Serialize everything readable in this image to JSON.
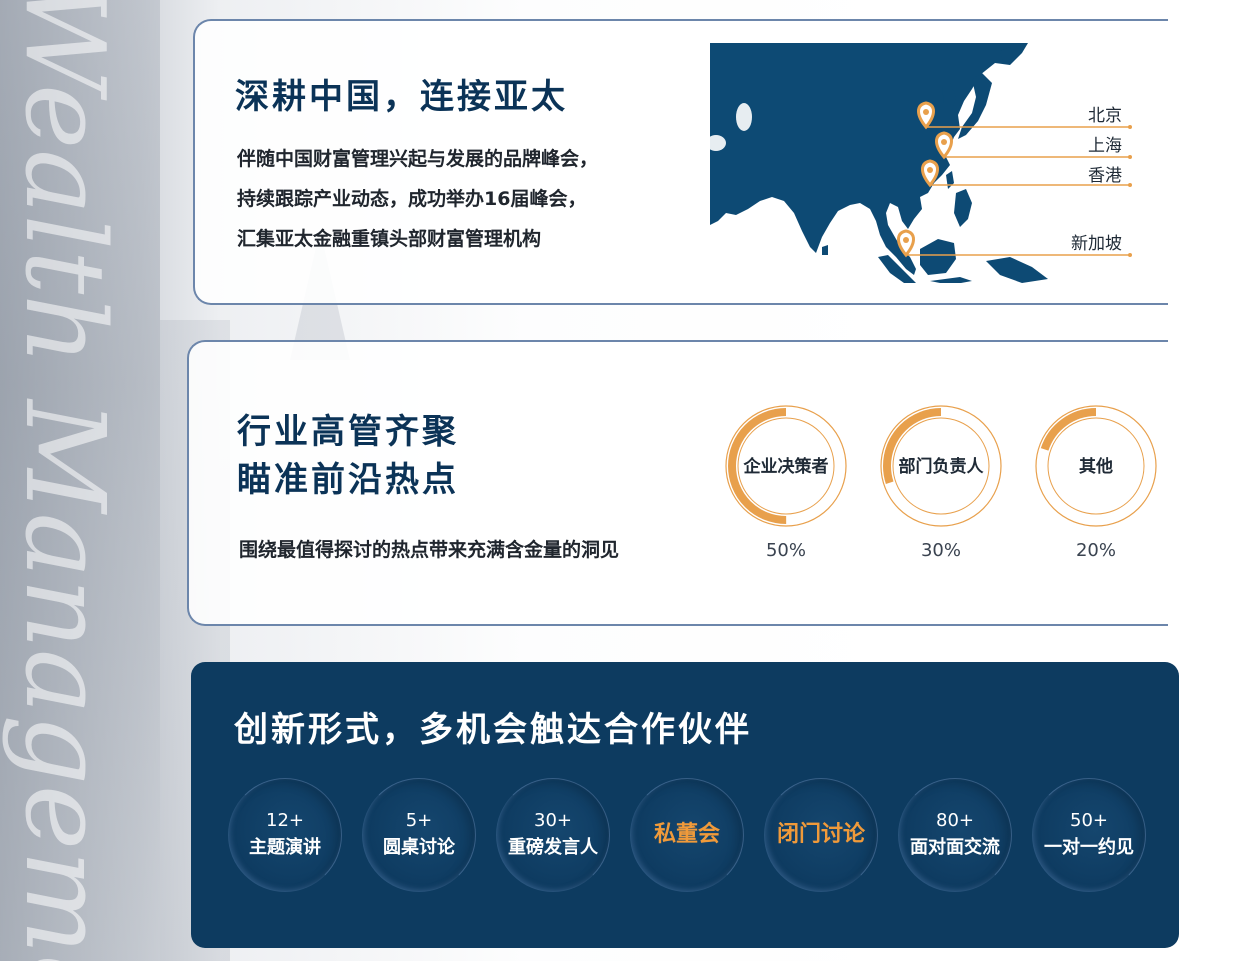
{
  "background": {
    "ghost_text": "Wealth Management"
  },
  "section1": {
    "title": "深耕中国，连接亚太",
    "lines": [
      "伴随中国财富管理兴起与发展的品牌峰会，",
      "持续跟踪产业动态，成功举办16届峰会，",
      "汇集亚太金融重镇头部财富管理机构"
    ],
    "map": {
      "cities": [
        "北京",
        "上海",
        "香港",
        "新加坡"
      ],
      "land_color": "#0d4a74",
      "marker_color": "#e8a04c"
    }
  },
  "section2": {
    "title_lines": [
      "行业高管齐聚",
      "瞄准前沿热点"
    ],
    "description": "围绕最值得探讨的热点带来充满含金量的洞见"
  },
  "chart_data": {
    "type": "pie",
    "style": "donut",
    "categories": [
      "企业决策者",
      "部门负责人",
      "其他"
    ],
    "values": [
      50,
      30,
      20
    ],
    "value_labels": [
      "50%",
      "30%",
      "20%"
    ],
    "color": "#e8a04c"
  },
  "section3": {
    "title": "创新形式，多机会触达合作伙伴",
    "items": [
      {
        "num": "12+",
        "label": "主题演讲",
        "accent": false
      },
      {
        "num": "5+",
        "label": "圆桌讨论",
        "accent": false
      },
      {
        "num": "30+",
        "label": "重磅发言人",
        "accent": false
      },
      {
        "num": "",
        "label": "私董会",
        "accent": true
      },
      {
        "num": "",
        "label": "闭门讨论",
        "accent": true
      },
      {
        "num": "80+",
        "label": "面对面交流",
        "accent": false
      },
      {
        "num": "50+",
        "label": "一对一约见",
        "accent": false
      }
    ],
    "panel_color": "#0d3b60",
    "accent_color": "#f09a3a"
  }
}
